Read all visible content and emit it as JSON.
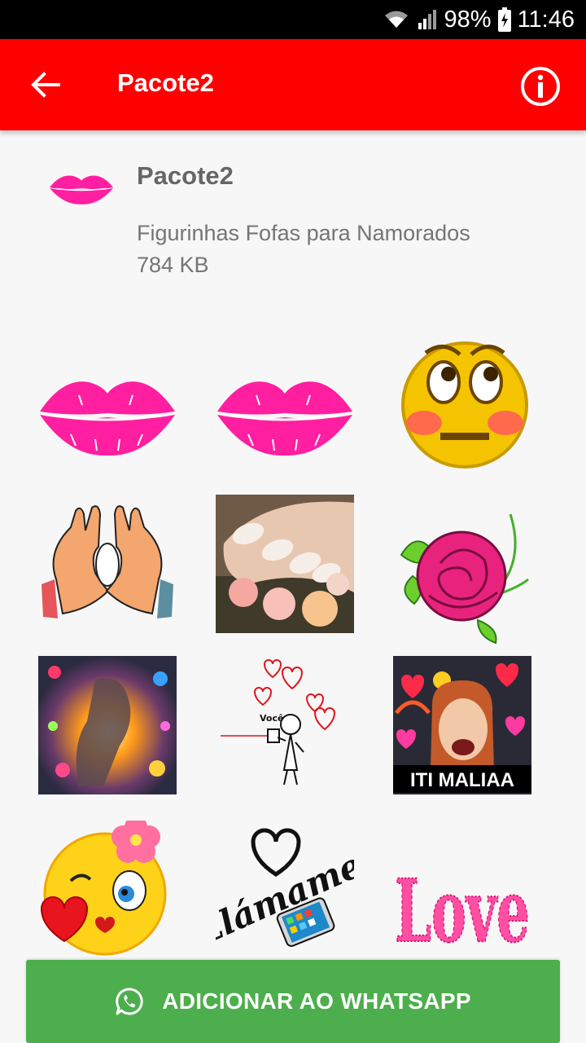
{
  "status_bar": {
    "battery": "98%",
    "time": "11:46"
  },
  "app_bar": {
    "title": "Pacote2",
    "back_icon": "arrow-left-icon",
    "info_icon": "info-icon"
  },
  "pack": {
    "name": "Pacote2",
    "description": "Figurinhas Fofas para Namorados",
    "size": "784 KB",
    "icon": "pink-lips-icon"
  },
  "stickers": [
    {
      "name": "pink-lips-1"
    },
    {
      "name": "pink-lips-2"
    },
    {
      "name": "blushing-emoji"
    },
    {
      "name": "heart-hands"
    },
    {
      "name": "nails-roses"
    },
    {
      "name": "pink-rose"
    },
    {
      "name": "couple-hearts-collage"
    },
    {
      "name": "voce-tin-can-phone",
      "text": "Você"
    },
    {
      "name": "iti-maliaa-meme",
      "text": "ITI MALIAA"
    },
    {
      "name": "winking-emoji-flower"
    },
    {
      "name": "llamame-phone",
      "text": "Llámame"
    },
    {
      "name": "love-hearts-letters",
      "text": "Love"
    }
  ],
  "actions": {
    "add_label": "ADICIONAR AO WHATSAPP",
    "add_icon": "whatsapp-icon"
  },
  "colors": {
    "app_bar": "#ff0000",
    "button": "#4cae4c",
    "lips": "#ff1fa0"
  }
}
